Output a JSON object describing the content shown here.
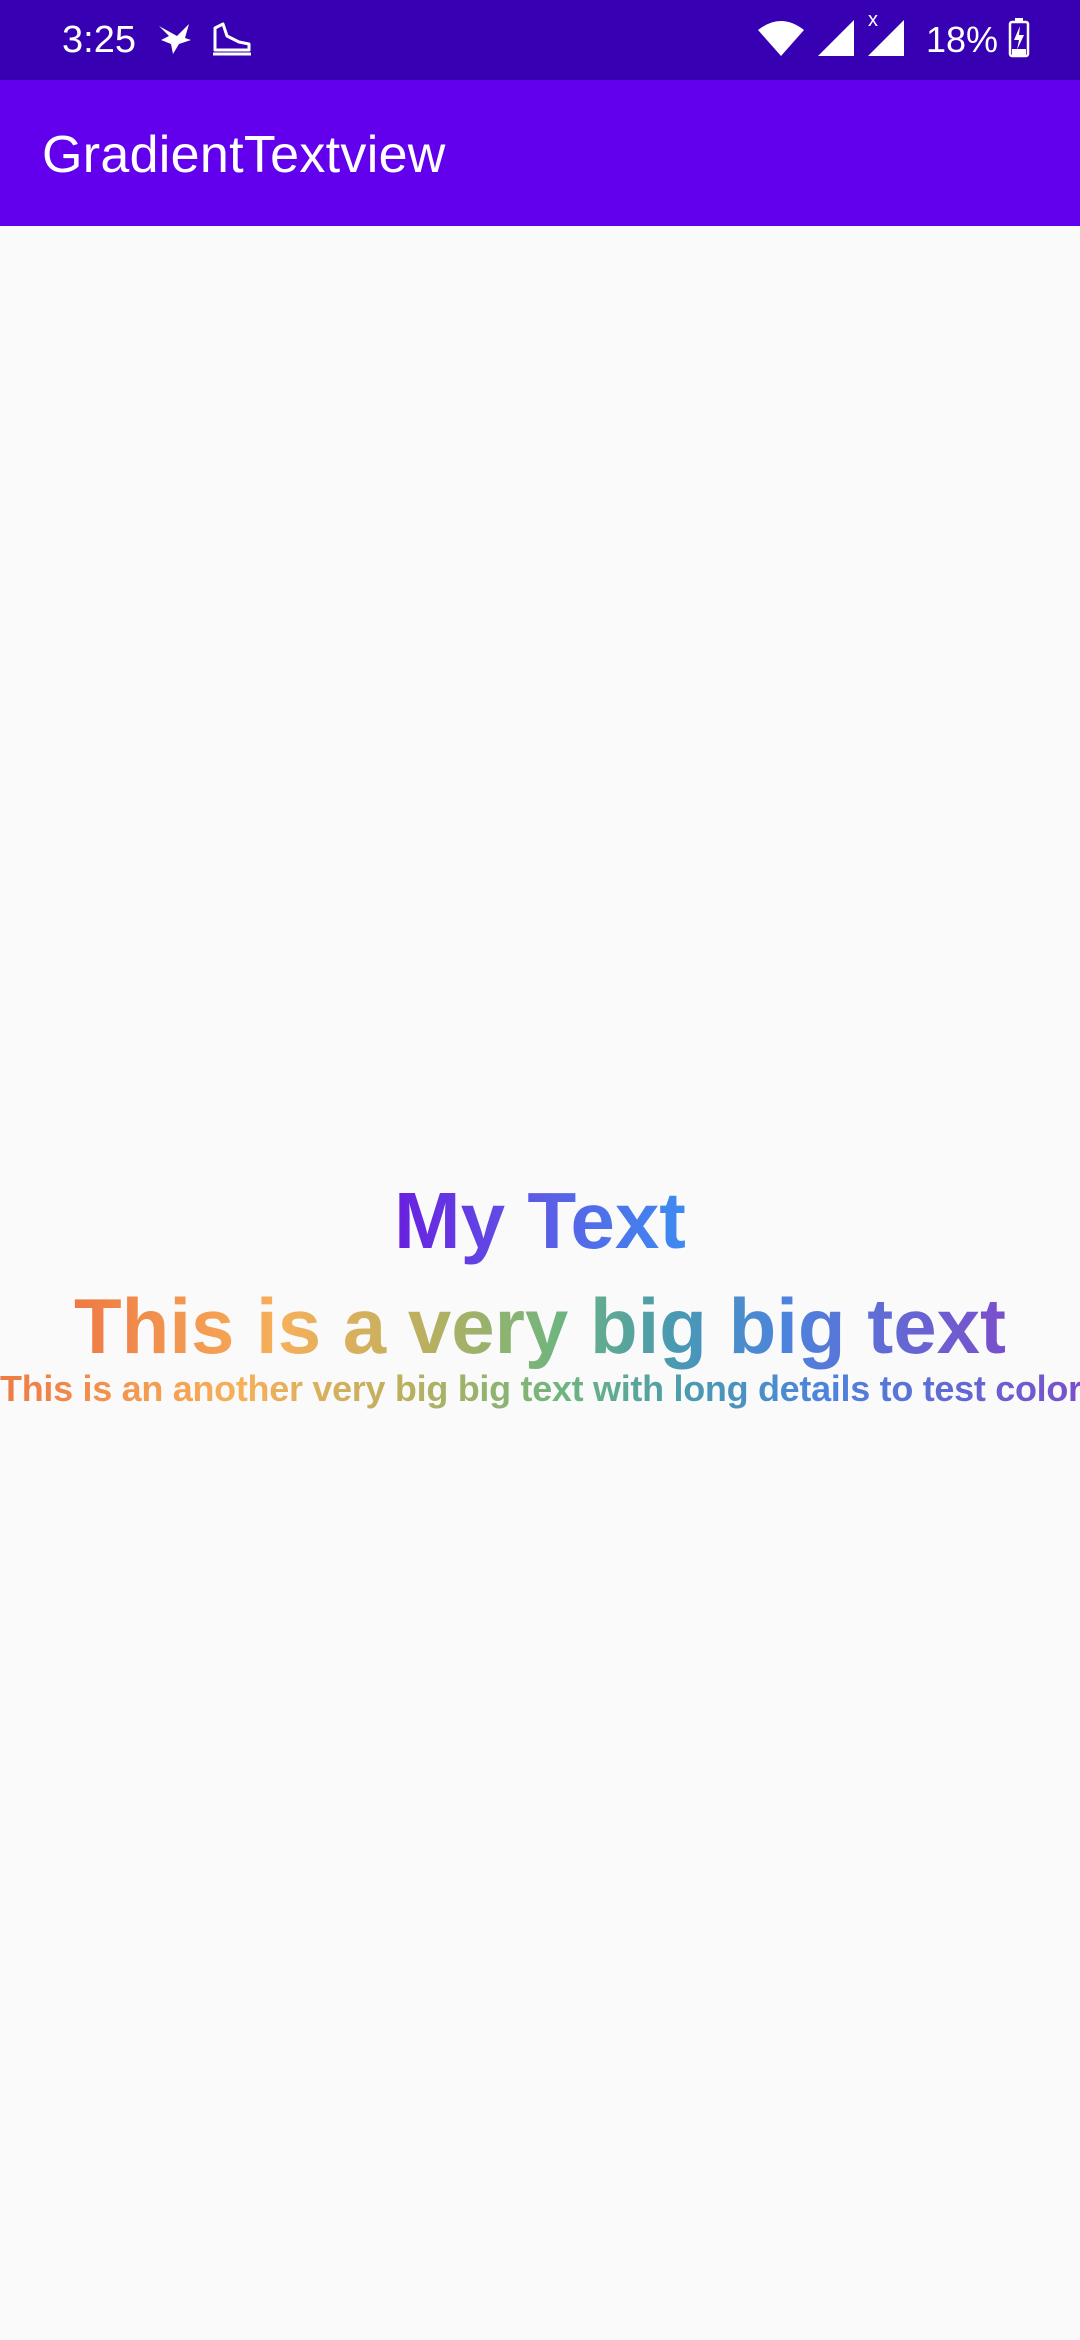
{
  "status_bar": {
    "time": "3:25",
    "left_icons": [
      "bird-notification-icon",
      "shoe-notification-icon"
    ],
    "right_icons": [
      "wifi-icon",
      "signal-icon",
      "signal-no-data-icon",
      "battery-charging-icon"
    ],
    "no_data_mark": "x",
    "battery": "18%"
  },
  "app_bar": {
    "title": "GradientTextview"
  },
  "main": {
    "text_1": "My Text",
    "text_2": "This is a very big big text",
    "text_3": "This is an another very big big text with long details to test color"
  },
  "colors": {
    "status_bar": "#3700B3",
    "app_bar": "#6200EE",
    "background": "#FAFAFA",
    "gradient_purple_blue": [
      "#6A1FE0",
      "#5C5CE6",
      "#3D8CF0"
    ],
    "gradient_rainbow": [
      "#EE7A45",
      "#F7B05A",
      "#B8B060",
      "#6FB57E",
      "#4A9AB0",
      "#4C84DD",
      "#7A4FCB"
    ]
  }
}
